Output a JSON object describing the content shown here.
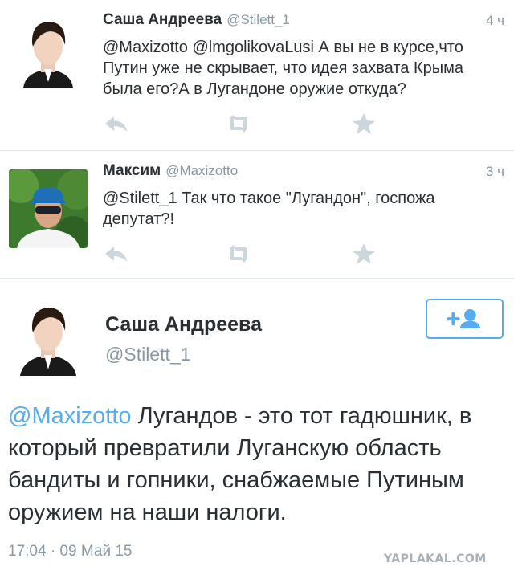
{
  "tweets": [
    {
      "name": "Саша Андреева",
      "handle": "@Stilett_1",
      "time": "4 ч",
      "text": "@Maxizotto @lmgolikovaLusi А вы не в  курсе,что Путин уже не скрывает, что идея захвата Крыма была его?А в Лугандоне оружие откуда?"
    },
    {
      "name": "Максим",
      "handle": "@Maxizotto",
      "time": "3 ч",
      "text": "@Stilett_1 Так что такое \"Лугандон\", госпожа депутат?!"
    }
  ],
  "main": {
    "name": "Саша Андреева",
    "handle": "@Stilett_1",
    "mention": "@Maxizotto",
    "text": " Лугандов - это тот гадюшник, в который превратили Луганскую область бандиты и гопники, снабжаемые Путиным оружием на наши налоги.",
    "timestamp": "17:04 · 09 Май 15"
  },
  "watermark": "YAPLAKAL.COM",
  "icons": {
    "reply": "reply-icon",
    "retweet": "retweet-icon",
    "favorite": "star-icon",
    "follow": "add-user-icon"
  },
  "colors": {
    "accent": "#55acee",
    "muted": "#8899a6",
    "text": "#292f33",
    "icon": "#ccd6dd"
  }
}
